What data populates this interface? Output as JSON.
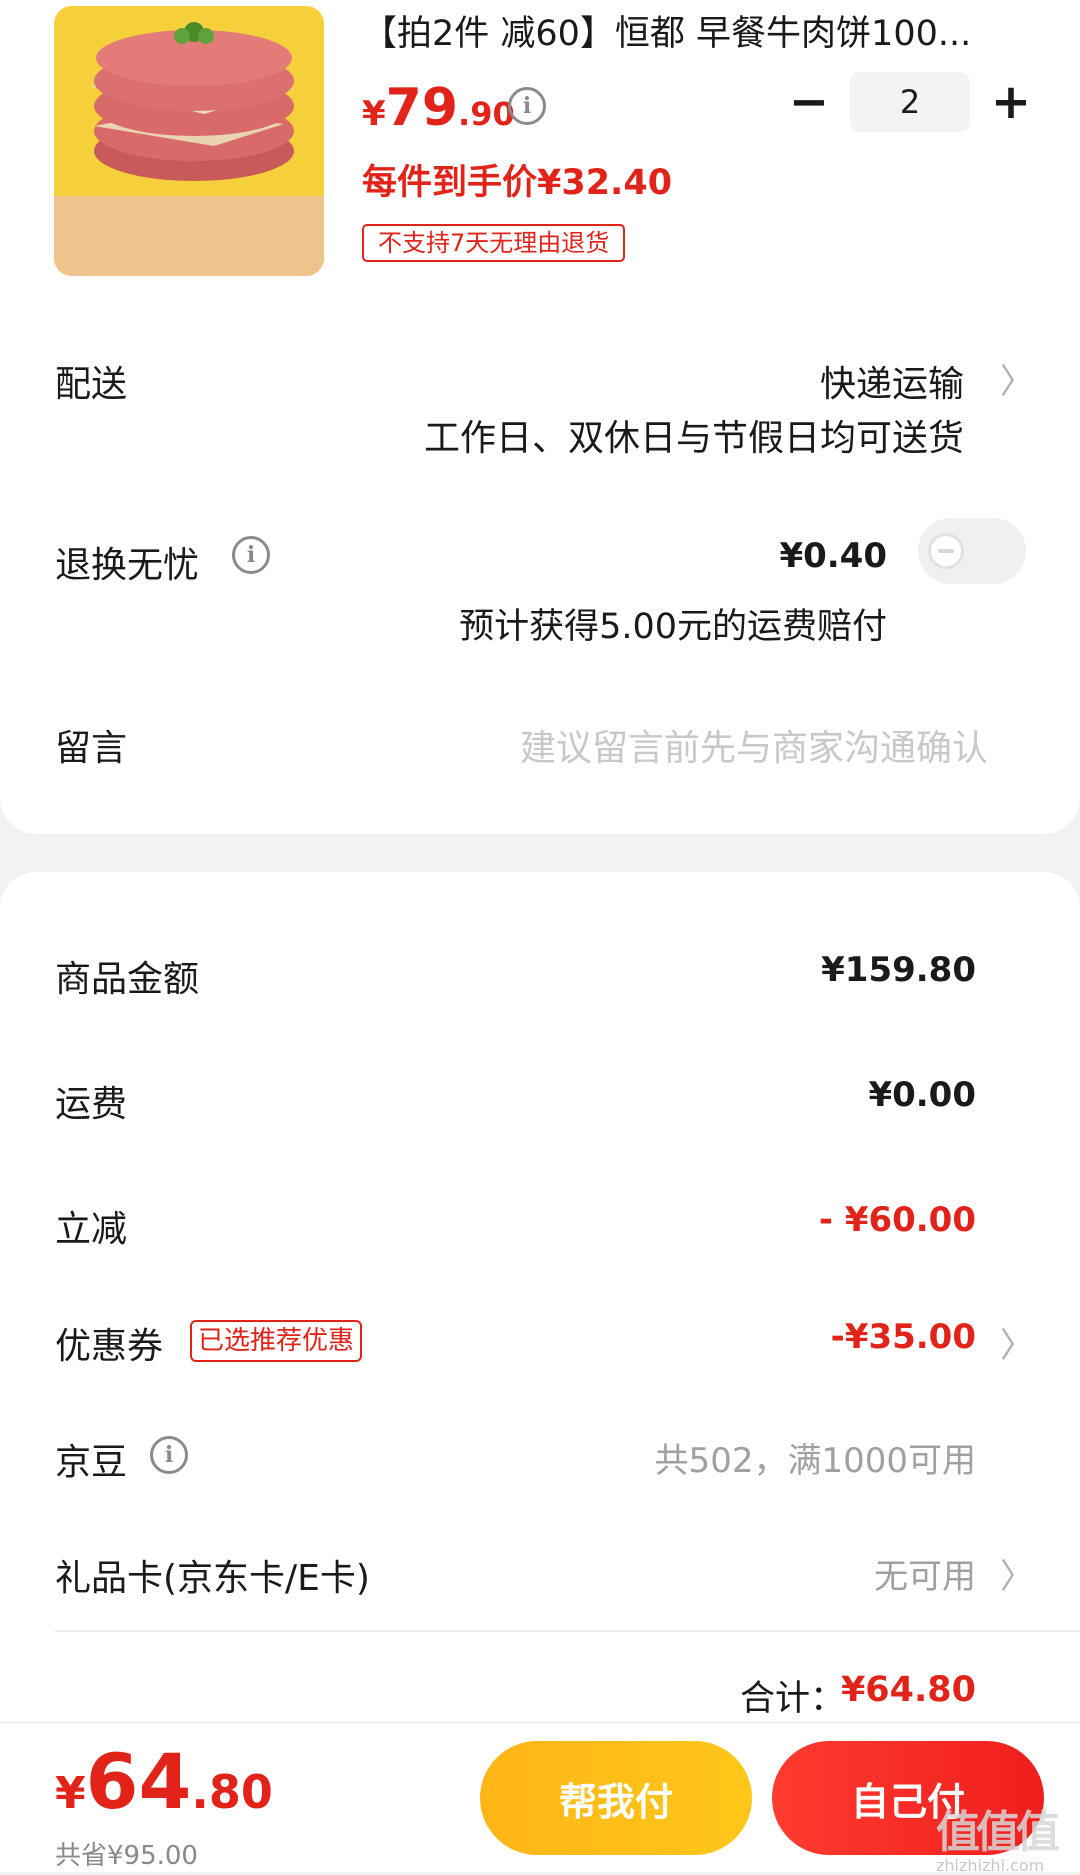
{
  "product": {
    "title": "【拍2件 减60】恒都 早餐牛肉饼100...",
    "price_yen": "¥",
    "price_int": "79",
    "price_dec": ".90",
    "quantity": "2",
    "minus_label": "−",
    "plus_label": "+",
    "unit_price_label": "每件到手价¥32.40",
    "return_tag": "不支持7天无理由退货"
  },
  "delivery": {
    "label": "配送",
    "type": "快递运输",
    "desc": "工作日、双休日与节假日均可送货"
  },
  "return_service": {
    "label": "退换无忧",
    "price": "¥0.40",
    "desc": "预计获得5.00元的运费赔付",
    "toggle_on": false
  },
  "remark": {
    "label": "留言",
    "placeholder": "建议留言前先与商家沟通确认"
  },
  "summary": {
    "goods_label": "商品金额",
    "goods_value": "¥159.80",
    "shipping_label": "运费",
    "shipping_value": "¥0.00",
    "discount_label": "立减",
    "discount_value": "- ¥60.00",
    "coupon_label": "优惠券",
    "coupon_tag": "已选推荐优惠",
    "coupon_value": "-¥35.00",
    "beans_label": "京豆",
    "beans_value": "共502，满1000可用",
    "giftcard_label": "礼品卡(京东卡/E卡)",
    "giftcard_value": "无可用",
    "total_label": "合计：",
    "total_value": "¥64.80"
  },
  "bottom_bar": {
    "pay_yen": "¥",
    "pay_int": "64",
    "pay_dec": ".80",
    "saved": "共省¥95.00",
    "help_pay": "帮我付",
    "self_pay": "自己付"
  },
  "watermark": {
    "big": "值值值",
    "small": "zhizhizhi.com"
  },
  "colors": {
    "accent_red": "#e2231a",
    "help_btn": "#ffb516",
    "self_btn": "#f01e1e"
  }
}
